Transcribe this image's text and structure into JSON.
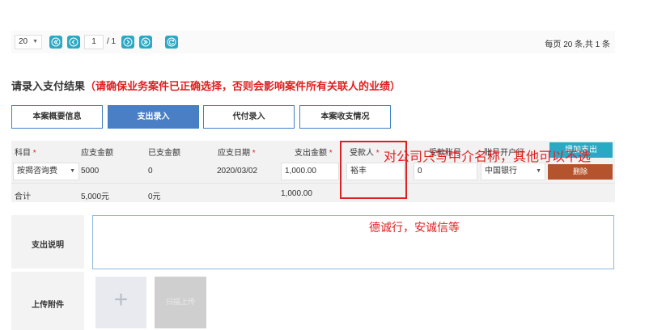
{
  "pager": {
    "page_size": "20",
    "current_page": "1",
    "total_pages": "/ 1",
    "summary": "每页 20 条,共 1 条"
  },
  "section": {
    "title": "请录入支付结果",
    "warning": "（请确保业务案件已正确选择，否则会影响案件所有关联人的业绩）"
  },
  "tabs": [
    "本案概要信息",
    "支出录入",
    "代付录入",
    "本案收支情况"
  ],
  "table": {
    "headers": {
      "subject": "科目",
      "payable": "应支金额",
      "paid": "已支金额",
      "due_date": "应支日期",
      "amount": "支出金额",
      "payee": "受款人",
      "account": "受款账号",
      "bank": "账号开户行"
    },
    "add_button": "增加支出",
    "row": {
      "subject": "按揭咨询费",
      "payable": "5000",
      "paid": "0",
      "due_date": "2020/03/02",
      "amount": "1,000.00",
      "payee": "裕丰",
      "account": "0",
      "bank": "中国银行",
      "delete_button": "删除"
    },
    "total": {
      "label": "合计",
      "payable": "5,000元",
      "paid": "0元",
      "amount": "1,000.00"
    }
  },
  "annotations": {
    "note1": "对公司只写中介名称，其他可以不选",
    "note2": "德诚行，安诚信等"
  },
  "description": {
    "label": "支出说明",
    "value": ""
  },
  "upload": {
    "label": "上传附件",
    "add_symbol": "+",
    "scan_label": "扫描上传"
  },
  "colors": {
    "accent": "#2aa8c4",
    "tab_active": "#4a7fc6",
    "danger": "#b5532c",
    "annotation": "#e02020"
  }
}
